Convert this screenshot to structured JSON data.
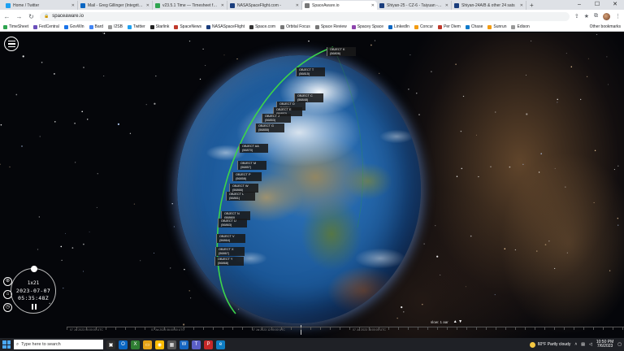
{
  "browser": {
    "tabs": [
      {
        "title": "Home / Twitter",
        "color": "#1da1f2"
      },
      {
        "title": "Mail - Greg Gillinger (Integrity S",
        "color": "#0a66c2"
      },
      {
        "title": "v23.5.1 Time — Timesheet for G",
        "color": "#2ea44f"
      },
      {
        "title": "NASASpaceFlight.com -",
        "color": "#1a3d7c"
      },
      {
        "title": "SpaceAware.io",
        "color": "#777777"
      },
      {
        "title": "Shiyan-25 - CZ-6 - Taiyuan - Ju",
        "color": "#1a3d7c"
      },
      {
        "title": "Shiyan-24A/B & other 24 sats",
        "color": "#1a3d7c"
      }
    ],
    "new_tab": "+",
    "window_controls": [
      "–",
      "☐",
      "✕"
    ],
    "url": "spaceaware.io",
    "bookmarks": [
      {
        "label": "TimeSheet",
        "color": "#2ea44f"
      },
      {
        "label": "FedCentral",
        "color": "#6b4fbb"
      },
      {
        "label": "GovWin",
        "color": "#1a73e8"
      },
      {
        "label": "Bard",
        "color": "#4285f4"
      },
      {
        "label": "I2SB",
        "color": "#999999"
      },
      {
        "label": "Twitter",
        "color": "#1da1f2"
      },
      {
        "label": "Starlink",
        "color": "#222222"
      },
      {
        "label": "SpaceNews",
        "color": "#c0392b"
      },
      {
        "label": "NASASpaceFlight",
        "color": "#1a3d7c"
      },
      {
        "label": "Space.com",
        "color": "#333333"
      },
      {
        "label": "Orbital Focus",
        "color": "#777777"
      },
      {
        "label": "Space Review",
        "color": "#777777"
      },
      {
        "label": "Spacey Space",
        "color": "#8e44ad"
      },
      {
        "label": "LinkedIn",
        "color": "#0a66c2"
      },
      {
        "label": "Concur",
        "color": "#f39c12"
      },
      {
        "label": "Per Diem",
        "color": "#c0392b"
      },
      {
        "label": "Chase",
        "color": "#117aca"
      },
      {
        "label": "Sunrun",
        "color": "#f39c12"
      },
      {
        "label": "Edison",
        "color": "#999999"
      }
    ],
    "other_bookmarks": "Other bookmarks"
  },
  "app": {
    "objects": [
      {
        "name": "OBJECT K",
        "id": "(56806)"
      },
      {
        "name": "OBJECT T",
        "id": "(56815)"
      },
      {
        "name": "OBJECT C",
        "id": "(56848)"
      },
      {
        "name": "OBJECT D",
        "id": "(56851)"
      },
      {
        "name": "OBJECT E",
        "id": "(56852)"
      },
      {
        "name": "OBJECT J",
        "id": "(56853)"
      },
      {
        "name": "OBJECT G",
        "id": "(56855)"
      },
      {
        "name": "OBJECT AA",
        "id": "(56870)"
      },
      {
        "name": "OBJECT M",
        "id": "(56857)"
      },
      {
        "name": "OBJECT P",
        "id": "(56858)"
      },
      {
        "name": "OBJECT W",
        "id": "(56866)"
      },
      {
        "name": "OBJECT L",
        "id": "(56861)"
      },
      {
        "name": "OBJECT N",
        "id": "(56860)"
      },
      {
        "name": "OBJECT U",
        "id": "(56863)"
      },
      {
        "name": "OBJECT V",
        "id": "(56864)"
      },
      {
        "name": "OBJECT X",
        "id": "(56867)"
      },
      {
        "name": "OBJECT Y",
        "id": "(56868)"
      }
    ],
    "clock": {
      "rate": "1x21",
      "date": "2023-07-07",
      "time": "05:35:48Z"
    },
    "timeline_ticks": [
      "07 Jul 2023 00:00:00 UTC",
      "07 Jul 2023 06:00:00 UTC",
      "07 Jul 2023 12:00:00 UTC",
      "07 Jul 2023 18:00:00 UTC"
    ],
    "speed_label": "slow: 1 aar",
    "speed_arrows": "▲ ▼"
  },
  "taskbar": {
    "search_placeholder": "Type here to search",
    "weather": "60°F  Partly cloudy",
    "time": "10:50 PM",
    "date": "7/6/2023"
  }
}
